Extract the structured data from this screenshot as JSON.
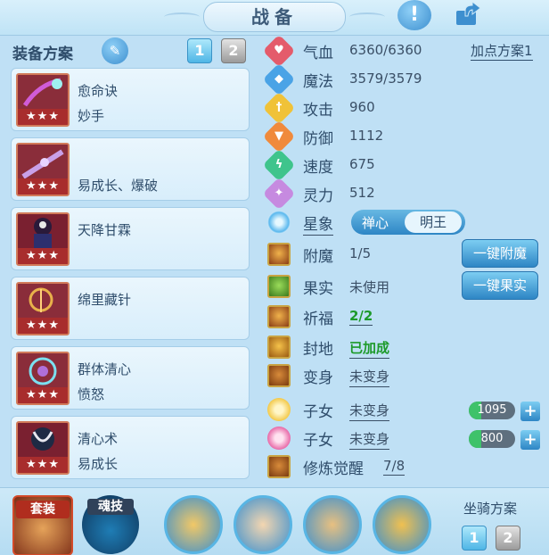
{
  "window": {
    "title": "战备",
    "help_label": "!",
    "share_icon": "share-icon"
  },
  "left": {
    "plan_label": "装备方案",
    "edit_icon": "pencil-icon",
    "plan_buttons": [
      "1",
      "2"
    ],
    "skills": [
      {
        "name": "愈命诀",
        "sub": "妙手",
        "stars": "★★★"
      },
      {
        "name": "",
        "sub": "易成长、爆破",
        "stars": "★★★"
      },
      {
        "name": "天降甘霖",
        "sub": "",
        "stars": "★★★"
      },
      {
        "name": "绵里藏针",
        "sub": "",
        "stars": "★★★"
      },
      {
        "name": "群体清心",
        "sub": "愤怒",
        "stars": "★★★"
      },
      {
        "name": "清心术",
        "sub": "易成长",
        "stars": "★★★"
      }
    ]
  },
  "stats": {
    "add_plan": "加点方案1",
    "rows": [
      {
        "label": "气血",
        "value": "6360/6360",
        "color": "#e45b6b",
        "icon": "heart-icon"
      },
      {
        "label": "魔法",
        "value": "3579/3579",
        "color": "#4aa3e6",
        "icon": "mana-icon"
      },
      {
        "label": "攻击",
        "value": "960",
        "color": "#f0c238",
        "icon": "sword-icon"
      },
      {
        "label": "防御",
        "value": "1112",
        "color": "#f08a3c",
        "icon": "shield-icon"
      },
      {
        "label": "速度",
        "value": "675",
        "color": "#3fc48c",
        "icon": "lightning-icon"
      },
      {
        "label": "灵力",
        "value": "512",
        "color": "#c68ae0",
        "icon": "spirit-icon"
      }
    ],
    "xingxiang": {
      "label": "星象",
      "opt1": "禅心",
      "opt2": "明王"
    },
    "fumo": {
      "label": "附魔",
      "value": "1/5",
      "button": "一键附魔"
    },
    "guoshi": {
      "label": "果实",
      "value": "未使用",
      "button": "一键果实"
    },
    "qifu": {
      "label": "祈福",
      "value": "2/2"
    },
    "fengdi": {
      "label": "封地",
      "value": "已加成"
    },
    "bianshen": {
      "label": "变身",
      "value": "未变身"
    },
    "zinv1": {
      "label": "子女",
      "value": "未变身",
      "bar": "1095"
    },
    "zinv2": {
      "label": "子女",
      "value": "未变身",
      "bar": "800"
    },
    "xiulian": {
      "label": "修炼觉醒",
      "value": "7/8"
    }
  },
  "bottom": {
    "set_label": "套装",
    "soul_label": "魂技",
    "mount_label": "坐骑方案",
    "mount_buttons": [
      "1",
      "2"
    ]
  }
}
